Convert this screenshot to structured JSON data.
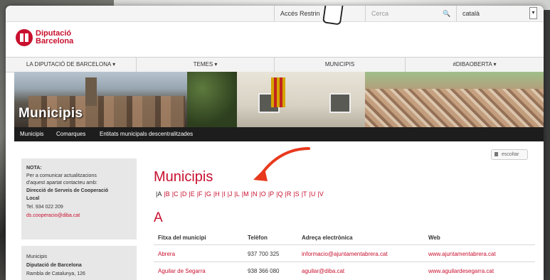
{
  "topbar": {
    "access_label": "Accés Restrin",
    "search_placeholder": "Cerca",
    "language": "català"
  },
  "logo": {
    "line1": "Diputació",
    "line2": "Barcelona"
  },
  "main_nav": [
    {
      "label": "LA DIPUTACIÓ DE BARCELONA ▾"
    },
    {
      "label": "TEMES ▾"
    },
    {
      "label": "MUNICIPIS"
    },
    {
      "label": "#DIBAOBERTA ▾"
    }
  ],
  "banner": {
    "title": "Municipis"
  },
  "sub_nav": [
    {
      "label": "Municipis"
    },
    {
      "label": "Comarques"
    },
    {
      "label": "Entitats municipals descentralitzades"
    }
  ],
  "escoltar": {
    "label": "escoltar"
  },
  "note": {
    "heading": "NOTA:",
    "line1": "Per a comunicar actualitzacions",
    "line2": "d'aquest apartat contacteu amb:",
    "org1": "Direcció de Serveis de Cooperació",
    "org2": "Local",
    "phone": "Tel. 934 022 209",
    "email": "ds.cooperacio@diba.cat"
  },
  "address": {
    "line1": "Municipis",
    "line2": "Diputació de Barcelona",
    "line3": "Rambla de Catalunya, 126"
  },
  "content": {
    "heading": "Municipis",
    "letters": [
      "A",
      "B",
      "C",
      "D",
      "E",
      "F",
      "G",
      "H",
      "I",
      "J",
      "L",
      "M",
      "N",
      "O",
      "P",
      "Q",
      "R",
      "S",
      "T",
      "U",
      "V"
    ],
    "current_letter": "A",
    "section_heading": "A",
    "columns": [
      "Fitxa del municipi",
      "Telèfon",
      "Adreça electrònica",
      "Web"
    ],
    "rows": [
      {
        "name": "Abrera",
        "phone": "937 700 325",
        "email": "informacio@ajuntamentabrera.cat",
        "web": "www.ajuntamentabrera.cat"
      },
      {
        "name": "Aguilar de Segarra",
        "phone": "938 366 080",
        "email": "aguilar@diba.cat",
        "web": "www.aguilardesegarra.cat"
      }
    ]
  }
}
